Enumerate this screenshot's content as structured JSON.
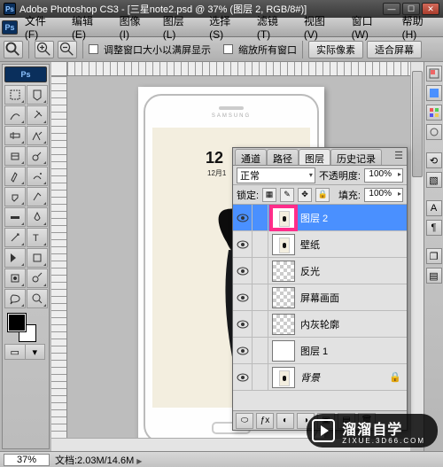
{
  "title": "Adobe Photoshop CS3 - [三星note2.psd @ 37% (图层 2, RGB/8#)]",
  "menus": [
    "文件(F)",
    "编辑(E)",
    "图像(I)",
    "图层(L)",
    "选择(S)",
    "滤镜(T)",
    "视图(V)",
    "窗口(W)",
    "帮助(H)"
  ],
  "options": {
    "chk1": "调整窗口大小以满屏显示",
    "chk2": "缩放所有窗口",
    "btn1": "实际像素",
    "btn2": "适合屏幕"
  },
  "canvas": {
    "brand": "SAMSUNG",
    "clock": "12",
    "date": "12月1"
  },
  "panel": {
    "tabs": [
      "通道",
      "路径",
      "图层",
      "历史记录"
    ],
    "active_tab": 2,
    "blend": "正常",
    "opacity_label": "不透明度:",
    "opacity_value": "100%",
    "lock_label": "锁定:",
    "fill_label": "填充:",
    "fill_value": "100%",
    "layers": [
      {
        "name": "图层 2",
        "selected": true,
        "thumb": "phone",
        "highlight": true
      },
      {
        "name": "壁纸",
        "selected": false,
        "thumb": "phone"
      },
      {
        "name": "反光",
        "selected": false,
        "thumb": "checker"
      },
      {
        "name": "屏幕画面",
        "selected": false,
        "thumb": "checker"
      },
      {
        "name": "内灰轮廓",
        "selected": false,
        "thumb": "checker"
      },
      {
        "name": "图层 1",
        "selected": false,
        "thumb": "white"
      },
      {
        "name": "背景",
        "selected": false,
        "thumb": "phone",
        "italic": true,
        "locked": true
      }
    ]
  },
  "status": {
    "zoom": "37%",
    "doc": "文档:2.03M/14.6M"
  },
  "watermark": {
    "big": "溜溜自学",
    "small": "ZIXUE.3D66.COM"
  }
}
